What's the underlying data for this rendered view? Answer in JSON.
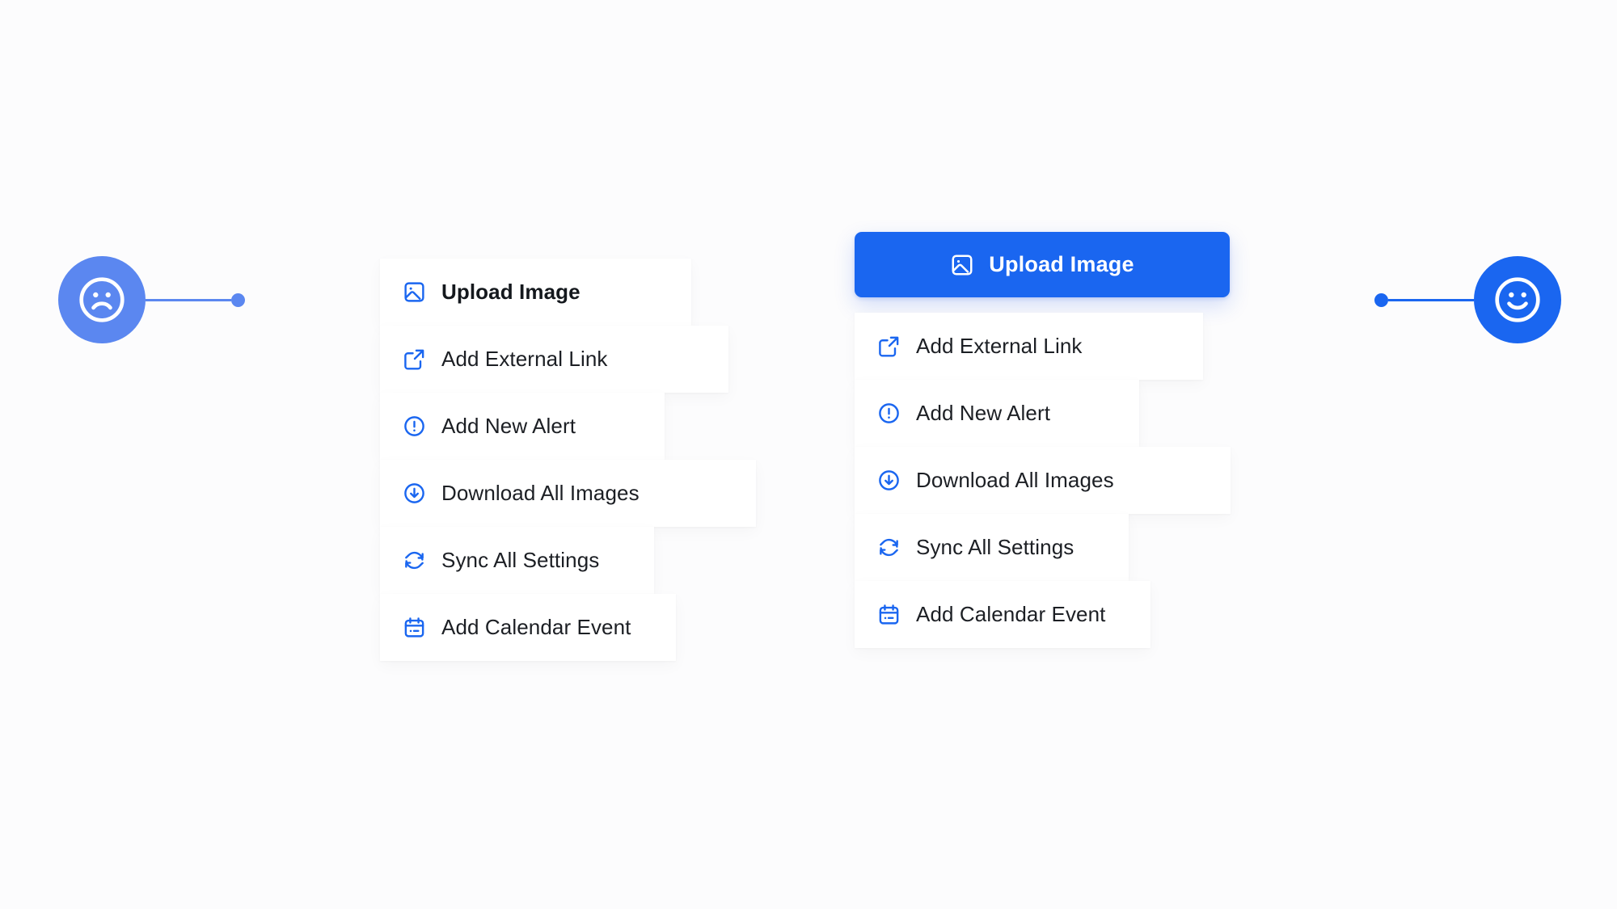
{
  "theme": {
    "background": "#FCFCFD",
    "card_background": "#FFFFFF",
    "accent_blue": "#1A66F0",
    "muted_blue": "#5B87F0",
    "text_primary": "#1C1F24",
    "text_on_accent": "#FFFFFF"
  },
  "markers": {
    "negative": {
      "name": "sad-face-marker",
      "icon": "sad-face-icon",
      "bubble_color": "#5B87F0",
      "dot_color": "#5B87F0",
      "line_color": "#5B87F0"
    },
    "positive": {
      "name": "happy-face-marker",
      "icon": "happy-face-icon",
      "bubble_color": "#1A66F0",
      "dot_color": "#1A66F0",
      "line_color": "#1A66F0"
    }
  },
  "panel_before": {
    "name": "menu-without-primary-action",
    "items": [
      {
        "label": "Upload Image",
        "icon": "image-icon",
        "emphasis": true
      },
      {
        "label": "Add External Link",
        "icon": "external-link-icon",
        "emphasis": false
      },
      {
        "label": "Add New Alert",
        "icon": "alert-circle-icon",
        "emphasis": false
      },
      {
        "label": "Download All Images",
        "icon": "download-icon",
        "emphasis": false
      },
      {
        "label": "Sync All Settings",
        "icon": "sync-icon",
        "emphasis": false
      },
      {
        "label": "Add Calendar Event",
        "icon": "calendar-icon",
        "emphasis": false
      }
    ]
  },
  "panel_after": {
    "name": "menu-with-primary-action",
    "primary_action": {
      "label": "Upload Image",
      "icon": "image-icon",
      "background": "#1A66F0",
      "text_color": "#FFFFFF"
    },
    "items": [
      {
        "label": "Add External Link",
        "icon": "external-link-icon",
        "emphasis": false
      },
      {
        "label": "Add New Alert",
        "icon": "alert-circle-icon",
        "emphasis": false
      },
      {
        "label": "Download All Images",
        "icon": "download-icon",
        "emphasis": false
      },
      {
        "label": "Sync All Settings",
        "icon": "sync-icon",
        "emphasis": false
      },
      {
        "label": "Add Calendar Event",
        "icon": "calendar-icon",
        "emphasis": false
      }
    ]
  }
}
